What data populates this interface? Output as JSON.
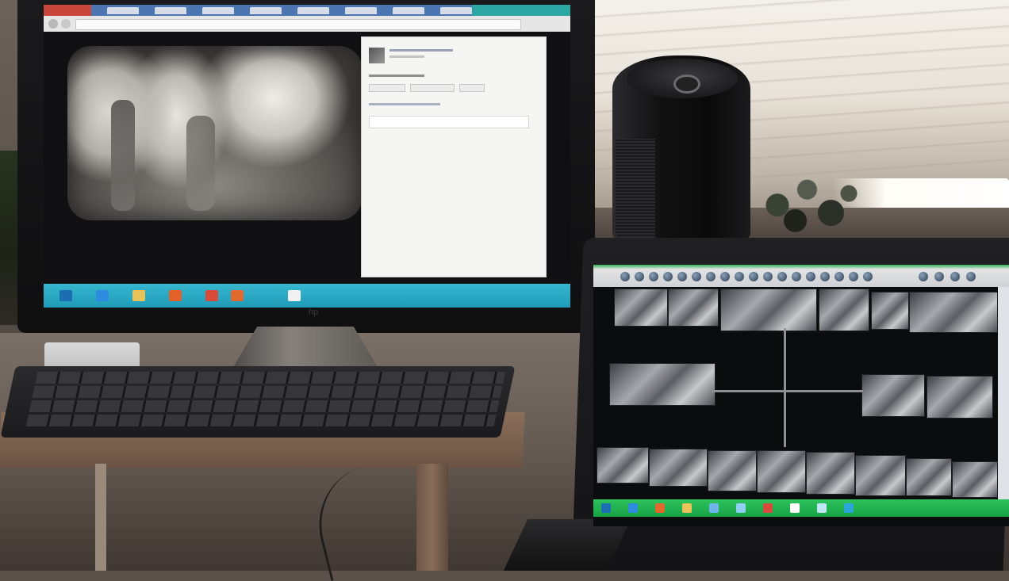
{
  "scene": {
    "description_colors": {
      "monitor_taskbar": "#2ba8c4",
      "laptop_taskbar": "#1fae4f",
      "laptop_toolbar_accent": "#2fb15a",
      "browser_tab_red": "#c9463d",
      "browser_tab_blue": "#4b76b2"
    }
  },
  "monitor": {
    "brand_logo": "hp",
    "browser": {
      "tab_count_visible": 8
    },
    "xray": {
      "icon": "dental-xray-image"
    },
    "social_post": {
      "avatar_icon": "avatar-icon"
    },
    "taskbar_icons": [
      "start-icon",
      "ie-icon",
      "folder-icon",
      "firefox-icon",
      "chrome-icon",
      "firefox-icon",
      "window-icon"
    ]
  },
  "laptop": {
    "toolbar_icon_count": 22,
    "film_count": 18
  }
}
